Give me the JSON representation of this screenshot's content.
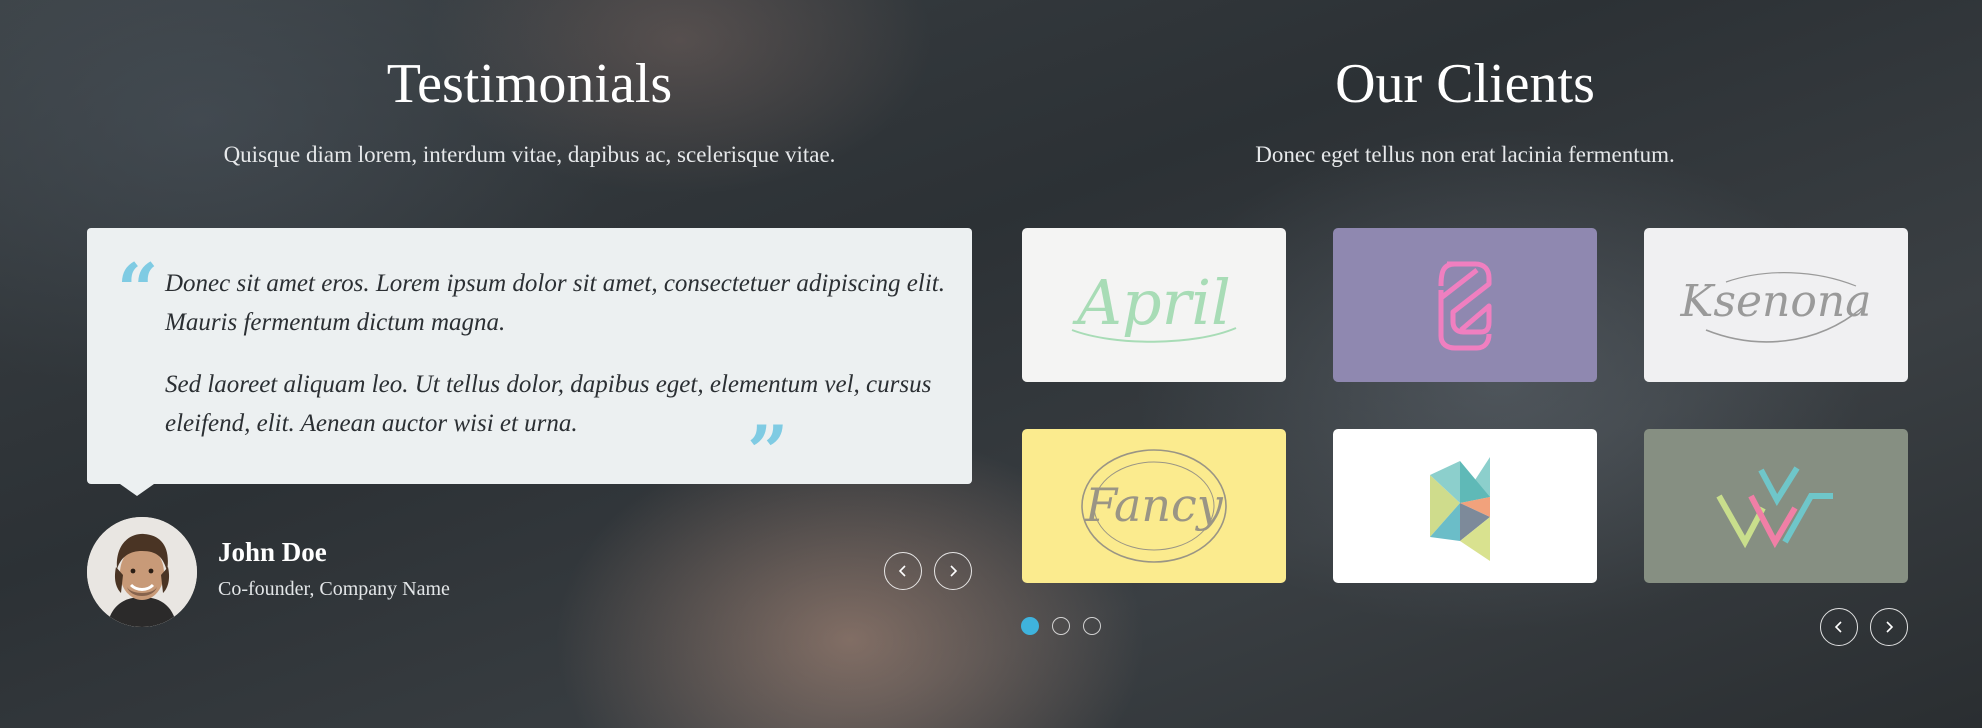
{
  "testimonials": {
    "title": "Testimonials",
    "subtitle": "Quisque diam lorem, interdum vitae, dapibus ac, scelerisque vitae.",
    "quote_paragraphs": [
      "Donec sit amet eros. Lorem ipsum dolor sit amet, consectetuer adipiscing elit. Mauris fermentum dictum magna.",
      "Sed laoreet aliquam leo. Ut tellus dolor, dapibus eget, elementum vel, cursus eleifend, elit. Aenean auctor wisi et urna."
    ],
    "author_name": "John Doe",
    "author_role": "Co-founder, Company Name",
    "avatar_icon": "person-portrait-icon",
    "nav_prev_icon": "chevron-left-icon",
    "nav_next_icon": "chevron-right-icon"
  },
  "clients": {
    "title": "Our Clients",
    "subtitle": "Donec eget tellus non erat lacinia fermentum.",
    "logos": [
      {
        "name": "April",
        "text": "April",
        "background": "#f4f4f3",
        "ink": "#a8dcb6"
      },
      {
        "name": "S-mark",
        "icon": "s-monogram-icon",
        "background": "#8f88b0",
        "ink": "#f07fc0"
      },
      {
        "name": "Ksenona",
        "text": "Ksenona",
        "background": "#f0f0f2",
        "ink": "#9a9a9a"
      },
      {
        "name": "Fancy",
        "text": "Fancy",
        "background": "#fbeb8e",
        "ink": "#9a9585"
      },
      {
        "name": "K-mark",
        "icon": "k-geometric-icon",
        "background": "#ffffff"
      },
      {
        "name": "W-mark",
        "icon": "w-chevrons-icon",
        "background": "#868f82"
      }
    ],
    "pagination": {
      "pages": 3,
      "active": 1,
      "active_color": "#3fb3dd"
    },
    "nav_prev_icon": "chevron-left-icon",
    "nav_next_icon": "chevron-right-icon"
  },
  "colors": {
    "quote_mark": "#7fcbe3",
    "quote_bg": "#ecf0f1",
    "accent": "#3fb3dd"
  }
}
